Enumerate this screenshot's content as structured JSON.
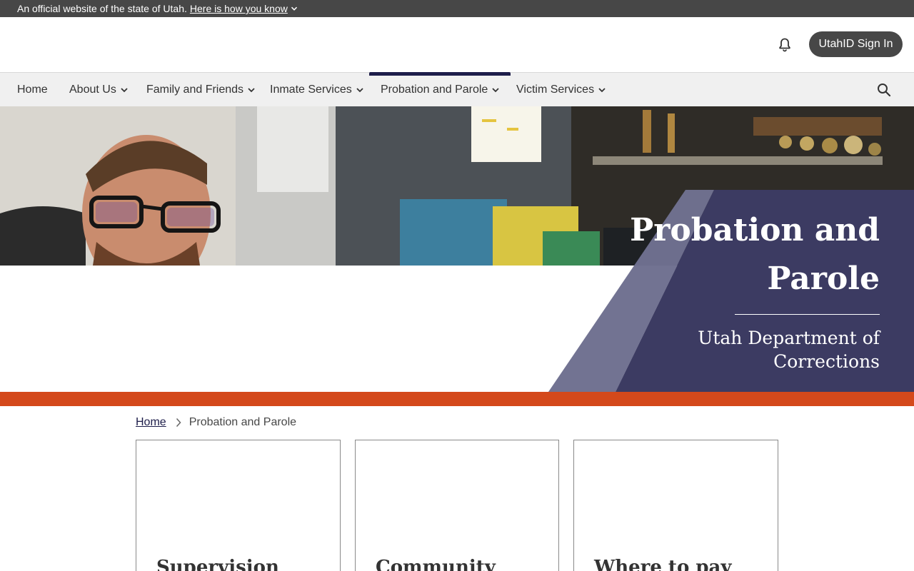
{
  "banner": {
    "text": "An official website of the state of Utah.",
    "link": "Here is how you know"
  },
  "header": {
    "signin_label": "UtahID Sign In",
    "notification_icon": "bell-icon"
  },
  "nav": {
    "items": [
      {
        "label": "Home",
        "has_dropdown": false
      },
      {
        "label": "About Us",
        "has_dropdown": true
      },
      {
        "label": "Family and Friends",
        "has_dropdown": true
      },
      {
        "label": "Inmate Services",
        "has_dropdown": true
      },
      {
        "label": "Probation and Parole",
        "has_dropdown": true,
        "active": true
      },
      {
        "label": "Victim Services",
        "has_dropdown": true
      }
    ],
    "search_icon": "search-icon"
  },
  "hero": {
    "title": "Probation and Parole",
    "subtitle": "Utah Department of Corrections"
  },
  "breadcrumb": {
    "home": "Home",
    "current": "Probation and Parole"
  },
  "cards": [
    {
      "title": "Supervision"
    },
    {
      "title": "Community"
    },
    {
      "title": "Where to pay"
    }
  ],
  "colors": {
    "banner_bg": "#474747",
    "nav_bg": "#f0f0f0",
    "nav_active": "#1d1d4a",
    "hero_panel": "#3c3b62",
    "hero_panel_light": "#6f7090",
    "accent_orange": "#d4491b"
  }
}
